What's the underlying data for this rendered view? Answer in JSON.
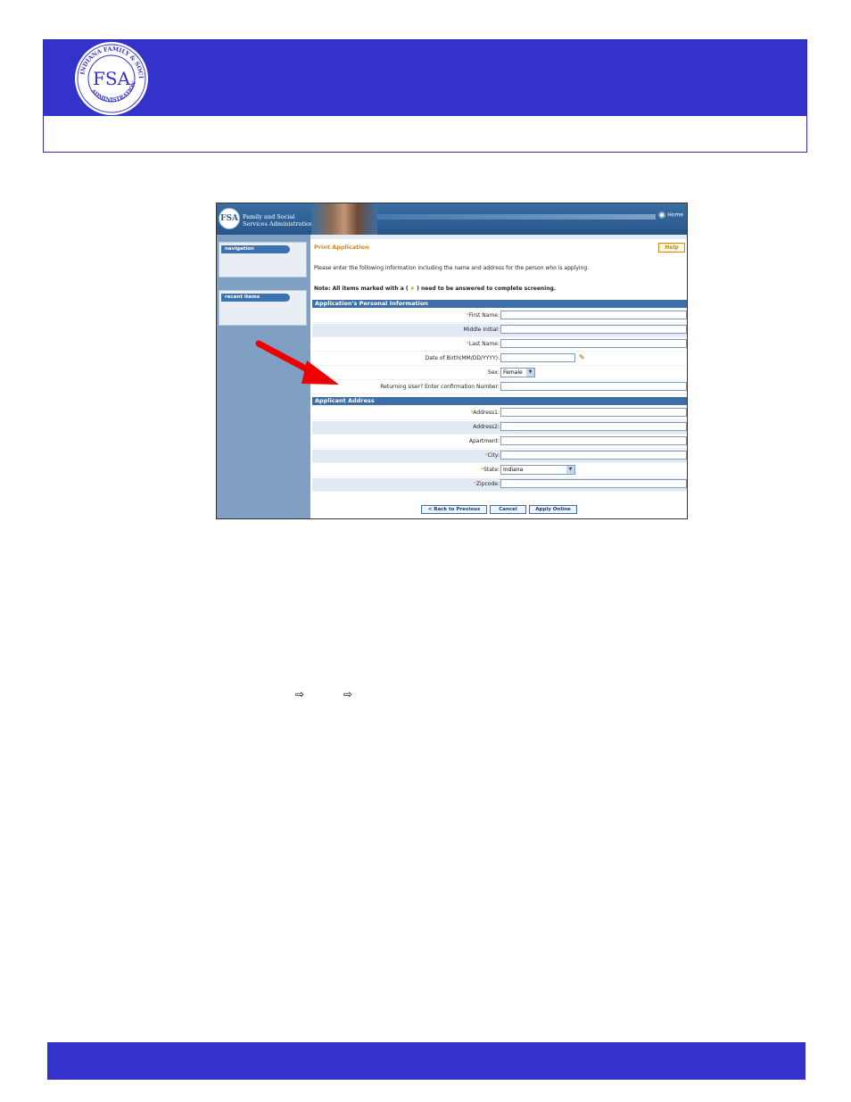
{
  "app": {
    "org_line1": "Family and Social",
    "org_line2": "Services Administration",
    "logo_text": "FSA",
    "home_label": "Home"
  },
  "sidebar": {
    "navigation_label": "navigation",
    "recent_label": "recent items"
  },
  "page": {
    "title": "Print Application",
    "help_label": "Help",
    "intro": "Please enter the following information including the name and address for the person who is applying.",
    "note_prefix": "Note: All items marked with a (",
    "note_star": "★",
    "note_suffix": ") need to be answered to complete screening."
  },
  "personal": {
    "section_title": "Application's Personal Information",
    "first_name": "First Name:",
    "middle_initial": "Middle Initial:",
    "last_name": "Last Name:",
    "dob": "Date of Birth(MM/DD/YYYY):",
    "sex": "Sex:",
    "sex_value": "Female",
    "returning": "Returning User? Enter confirmation Number:"
  },
  "address": {
    "section_title": "Applicant Address",
    "address1": "Address1:",
    "address2": "Address2:",
    "apartment": "Apartment:",
    "city": "City:",
    "state": "State:",
    "state_value": "Indiana",
    "zipcode": "Zipcode:"
  },
  "buttons": {
    "back": "< Back to Previous",
    "cancel": "Cancel",
    "apply": "Apply Online"
  },
  "req_marker": "*",
  "arrow_glyph": "⇨",
  "colors": {
    "banner": "#3333cc",
    "app_header": "#3c6ea3",
    "sidebar": "#7fa0c3",
    "accent_orange": "#d18a12",
    "arrow_red": "#ee0000"
  }
}
